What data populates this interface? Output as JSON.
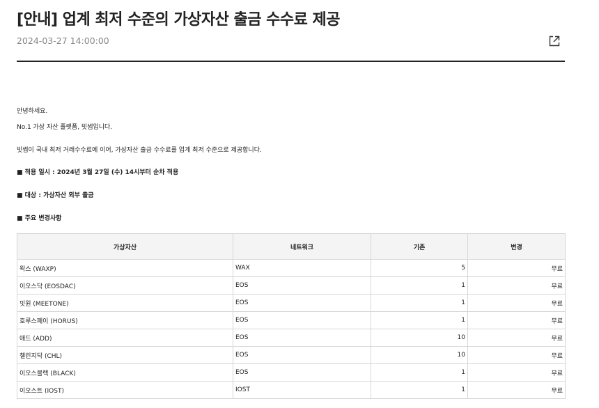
{
  "title": "[안내] 업계 최저 수준의 가상자산 출금 수수료 제공",
  "date": "2024-03-27 14:00:00",
  "share_icon": "external-link-icon",
  "body": {
    "greeting": "안녕하세요.",
    "intro": "No.1 가상 자산 플랫폼, 빗썸입니다.",
    "description": "빗썸이 국내 최저 거래수수료에 이어, 가상자산 출금 수수료를 업계 최저 수준으로 제공합니다.",
    "schedule": "■ 적용 일시 : 2024년 3월 27일 (수) 14시부터 순차 적용",
    "target": "■ 대상 : 가상자산 외부 출금",
    "changes_heading": "■ 주요 변경사항"
  },
  "table": {
    "headers": [
      "가상자산",
      "네트워크",
      "기존",
      "변경"
    ],
    "rows": [
      [
        "왁스 (WAXP)",
        "WAX",
        "5",
        "무료"
      ],
      [
        "이오스닥 (EOSDAC)",
        "EOS",
        "1",
        "무료"
      ],
      [
        "밋원 (MEETONE)",
        "EOS",
        "1",
        "무료"
      ],
      [
        "호루스페이 (HORUS)",
        "EOS",
        "1",
        "무료"
      ],
      [
        "애드 (ADD)",
        "EOS",
        "10",
        "무료"
      ],
      [
        "챌린지닥 (CHL)",
        "EOS",
        "10",
        "무료"
      ],
      [
        "이오스블랙 (BLACK)",
        "EOS",
        "1",
        "무료"
      ],
      [
        "이오스트 (IOST)",
        "IOST",
        "1",
        "무료"
      ]
    ]
  }
}
